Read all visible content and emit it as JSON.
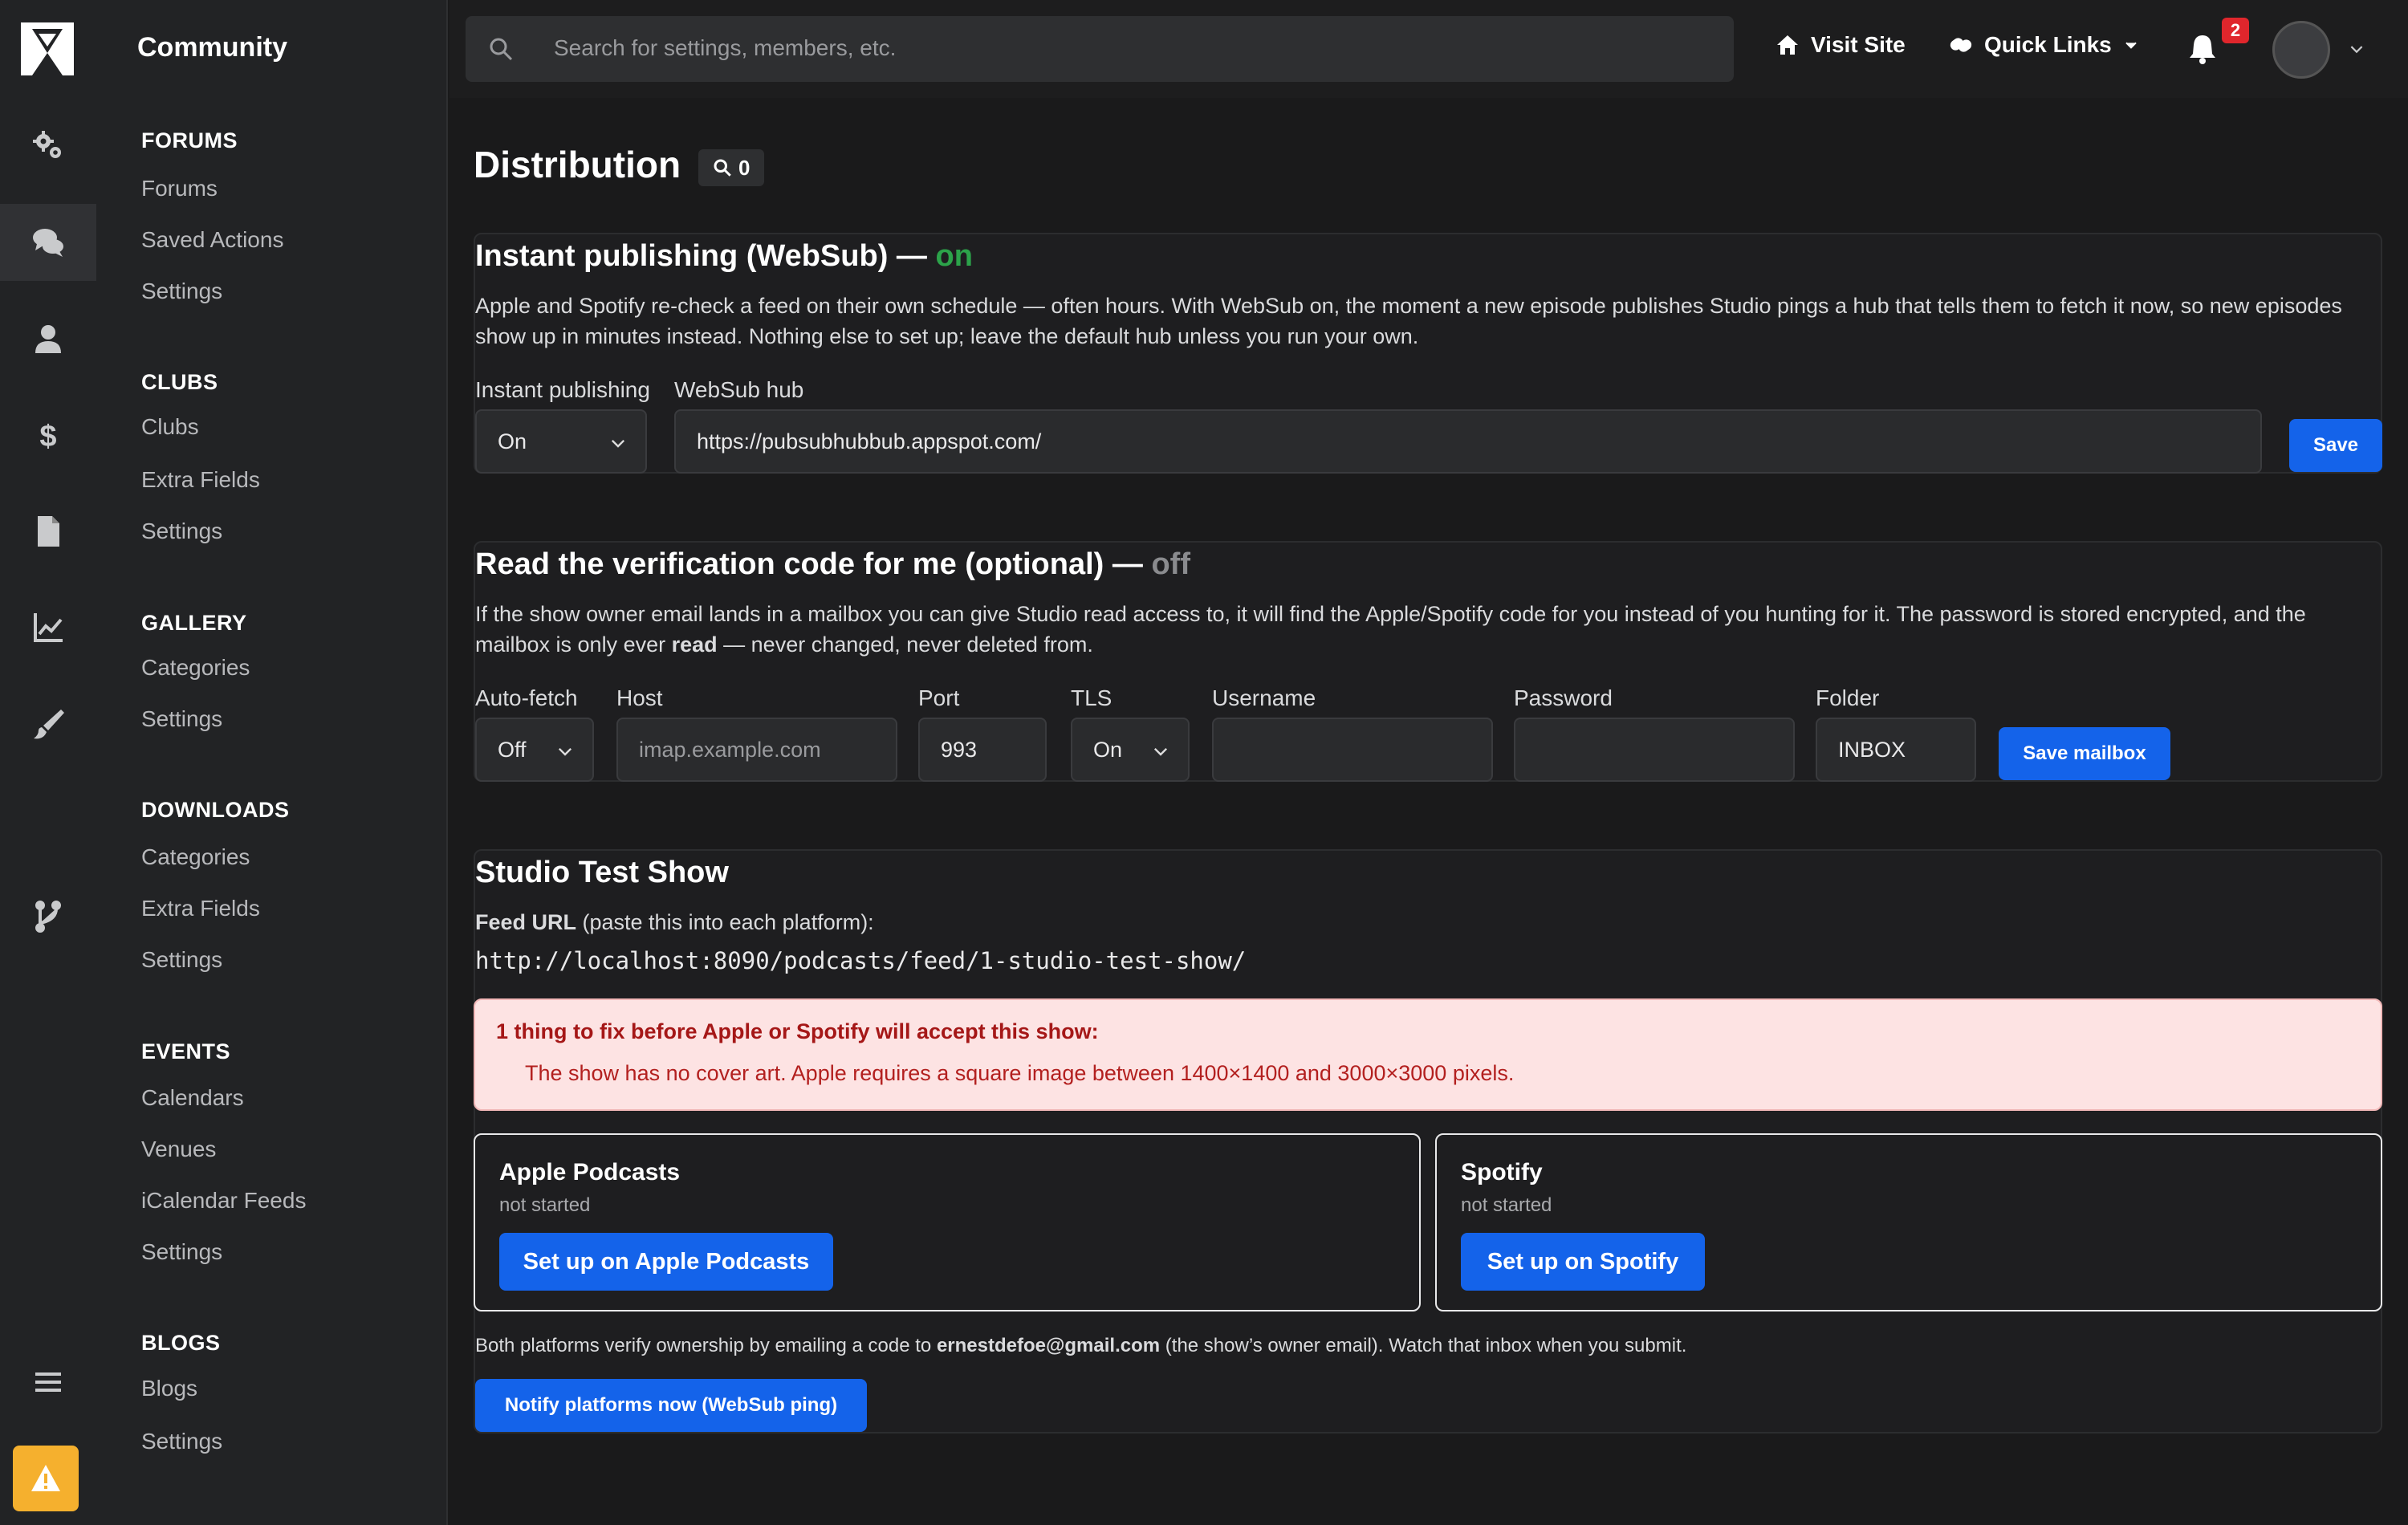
{
  "app": {
    "brand": "Community"
  },
  "rail": {
    "items": [
      "settings-icon",
      "chat-icon",
      "user-icon",
      "dollar-icon",
      "document-icon",
      "chart-icon",
      "brush-icon",
      "branch-icon",
      "menu-icon",
      "warning-icon"
    ],
    "active": "chat-icon"
  },
  "nav": {
    "sections": [
      {
        "title": "FORUMS",
        "links": [
          "Forums",
          "Saved Actions",
          "Settings"
        ]
      },
      {
        "title": "CLUBS",
        "links": [
          "Clubs",
          "Extra Fields",
          "Settings"
        ]
      },
      {
        "title": "GALLERY",
        "links": [
          "Categories",
          "Settings"
        ]
      },
      {
        "title": "DOWNLOADS",
        "links": [
          "Categories",
          "Extra Fields",
          "Settings"
        ]
      },
      {
        "title": "EVENTS",
        "links": [
          "Calendars",
          "Venues",
          "iCalendar Feeds",
          "Settings"
        ]
      },
      {
        "title": "BLOGS",
        "links": [
          "Blogs",
          "Settings"
        ]
      }
    ]
  },
  "topbar": {
    "search_placeholder": "Search for settings, members, etc.",
    "visit_site": "Visit Site",
    "quick_links": "Quick Links",
    "notification_count": "2"
  },
  "page": {
    "title": "Distribution",
    "search_count": "0"
  },
  "websub": {
    "title": "Instant publishing (WebSub) —",
    "state": "on",
    "description": "Apple and Spotify re-check a feed on their own schedule — often hours. With WebSub on, the moment a new episode publishes Studio pings a hub that tells them to fetch it now, so new episodes show up in minutes instead. Nothing else to set up; leave the default hub unless you run your own.",
    "instant_label": "Instant publishing",
    "instant_value": "On",
    "hub_label": "WebSub hub",
    "hub_value": "https://pubsubhubbub.appspot.com/",
    "save": "Save"
  },
  "verify": {
    "title": "Read the verification code for me (optional) —",
    "state": "off",
    "desc_a": "If the show owner email lands in a mailbox you can give Studio read access to, it will find the Apple/Spotify code for you instead of you hunting for it. The password is stored encrypted, and the mailbox is only ever ",
    "desc_bold": "read",
    "desc_b": " — never changed, never deleted from.",
    "autofetch_label": "Auto-fetch",
    "autofetch_value": "Off",
    "host_label": "Host",
    "host_placeholder": "imap.example.com",
    "port_label": "Port",
    "port_value": "993",
    "tls_label": "TLS",
    "tls_value": "On",
    "username_label": "Username",
    "password_label": "Password",
    "folder_label": "Folder",
    "folder_value": "INBOX",
    "save": "Save mailbox"
  },
  "show": {
    "title": "Studio Test Show",
    "feed_label": "Feed URL",
    "feed_hint": " (paste this into each platform):",
    "feed_url": "http://localhost:8090/podcasts/feed/1-studio-test-show/",
    "alert_title": "1 thing to fix before Apple or Spotify will accept this show:",
    "alert_item": "The show has no cover art. Apple requires a square image between 1400×1400 and 3000×3000 pixels.",
    "apple": {
      "title": "Apple Podcasts",
      "status": "not started",
      "button": "Set up on Apple Podcasts"
    },
    "spotify": {
      "title": "Spotify",
      "status": "not started",
      "button": "Set up on Spotify"
    },
    "footer_a": "Both platforms verify ownership by emailing a code to ",
    "footer_email": "ernestdefoe@gmail.com",
    "footer_b": " (the show’s owner email). Watch that inbox when you submit.",
    "notify": "Notify platforms now (WebSub ping)"
  },
  "colors": {
    "accent": "#1463ea",
    "on": "#2ca34a",
    "alert_bg": "#fde3e3",
    "warning": "#f5b02e"
  }
}
